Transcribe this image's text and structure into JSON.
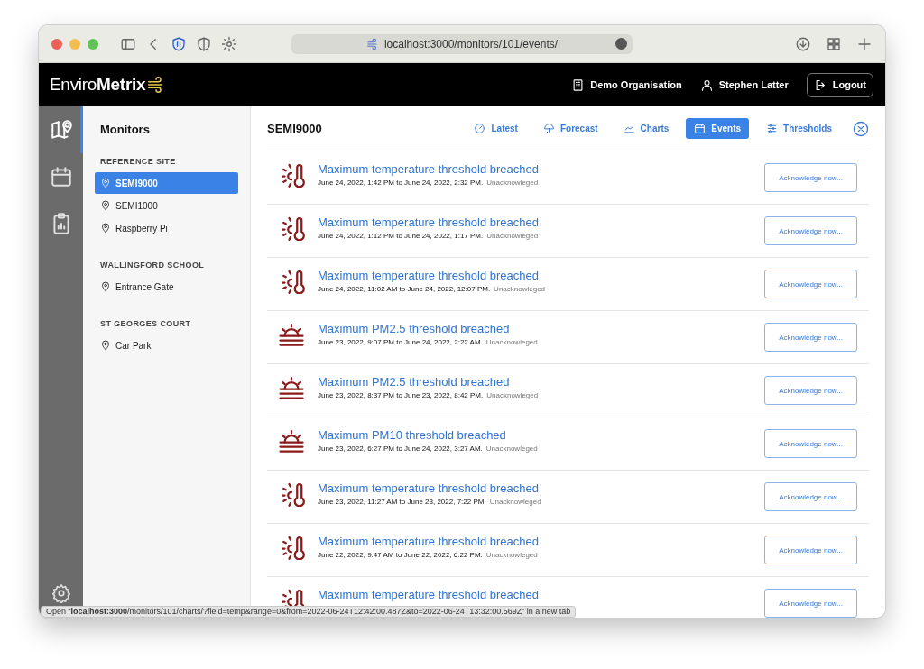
{
  "browser": {
    "url": "localhost:3000/monitors/101/events/"
  },
  "header": {
    "logo": "Enviro**Metrix**",
    "organisation": "Demo Organisation",
    "user": "Stephen Latter",
    "logout": "Logout"
  },
  "rail": {
    "items": [
      {
        "kind": "map",
        "selected": true
      },
      {
        "kind": "calendar",
        "selected": false
      },
      {
        "kind": "report",
        "selected": false
      }
    ]
  },
  "sidebar": {
    "title": "Monitors",
    "groups": [
      {
        "name": "REFERENCE SITE",
        "monitors": [
          {
            "name": "SEMI9000",
            "selected": true
          },
          {
            "name": "SEMI1000",
            "selected": false
          },
          {
            "name": "Raspberry Pi",
            "selected": false
          }
        ]
      },
      {
        "name": "WALLINGFORD SCHOOL",
        "monitors": [
          {
            "name": "Entrance Gate",
            "selected": false
          }
        ]
      },
      {
        "name": "ST GEORGES COURT",
        "monitors": [
          {
            "name": "Car Park",
            "selected": false
          }
        ]
      }
    ]
  },
  "main": {
    "title": "SEMI9000",
    "tabs": [
      {
        "kind": "gauge",
        "label": "Latest",
        "selected": false
      },
      {
        "kind": "umbrella",
        "label": "Forecast",
        "selected": false
      },
      {
        "kind": "chart",
        "label": "Charts",
        "selected": false
      },
      {
        "kind": "calendar",
        "label": "Events",
        "selected": true
      },
      {
        "kind": "sliders",
        "label": "Thresholds",
        "selected": false
      }
    ],
    "events": [
      {
        "kind": "temperature",
        "title": "Maximum temperature threshold breached",
        "period": "June 24, 2022, 1:42 PM to June 24, 2022, 2:32 PM.",
        "status": "Unacknowleged",
        "action": "Acknowledge now..."
      },
      {
        "kind": "temperature",
        "title": "Maximum temperature threshold breached",
        "period": "June 24, 2022, 1:12 PM to June 24, 2022, 1:17 PM.",
        "status": "Unacknowleged",
        "action": "Acknowledge now..."
      },
      {
        "kind": "temperature",
        "title": "Maximum temperature threshold breached",
        "period": "June 24, 2022, 11:02 AM to June 24, 2022, 12:07 PM.",
        "status": "Unacknowleged",
        "action": "Acknowledge now..."
      },
      {
        "kind": "particulate",
        "title": "Maximum PM2.5 threshold breached",
        "period": "June 23, 2022, 9:07 PM to June 24, 2022, 2:22 AM.",
        "status": "Unacknowleged",
        "action": "Acknowledge now..."
      },
      {
        "kind": "particulate",
        "title": "Maximum PM2.5 threshold breached",
        "period": "June 23, 2022, 8:37 PM to June 23, 2022, 8:42 PM.",
        "status": "Unacknowleged",
        "action": "Acknowledge now..."
      },
      {
        "kind": "particulate",
        "title": "Maximum PM10 threshold breached",
        "period": "June 23, 2022, 6:27 PM to June 24, 2022, 3:27 AM.",
        "status": "Unacknowleged",
        "action": "Acknowledge now..."
      },
      {
        "kind": "temperature",
        "title": "Maximum temperature threshold breached",
        "period": "June 23, 2022, 11:27 AM to June 23, 2022, 7:22 PM.",
        "status": "Unacknowleged",
        "action": "Acknowledge now..."
      },
      {
        "kind": "temperature",
        "title": "Maximum temperature threshold breached",
        "period": "June 22, 2022, 9:47 AM to June 22, 2022, 6:22 PM.",
        "status": "Unacknowleged",
        "action": "Acknowledge now..."
      },
      {
        "kind": "temperature",
        "title": "Maximum temperature threshold breached",
        "action": "Acknowledge now..."
      }
    ]
  },
  "status_tooltip": "Open “**localhost:3000**/monitors/101/charts/?field=temp&range=0&from=2022-06-24T12:42:00.487Z&to=2022-06-24T13:32:00.569Z” in a new tab"
}
